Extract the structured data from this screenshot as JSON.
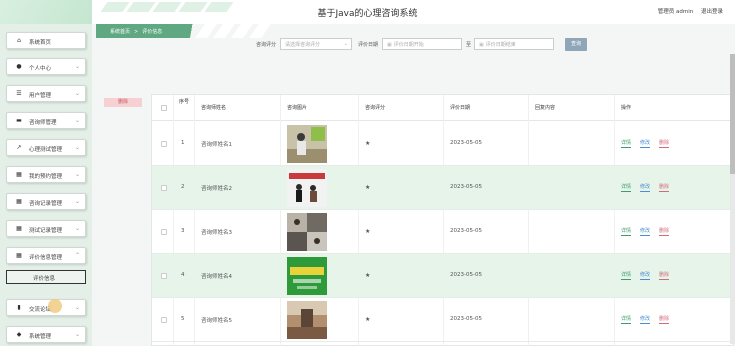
{
  "header": {
    "title": "基于Java的心理咨询系统",
    "user_label": "管理员 admin",
    "logout_label": "退出登录"
  },
  "sidebar": {
    "items": [
      {
        "label": "系统首页",
        "icon": "home-icon"
      },
      {
        "label": "个人中心",
        "icon": "user-icon"
      },
      {
        "label": "用户管理",
        "icon": "list-icon"
      },
      {
        "label": "咨询师管理",
        "icon": "briefcase-icon"
      },
      {
        "label": "心理测试管理",
        "icon": "chart-icon"
      },
      {
        "label": "我的预约管理",
        "icon": "grid-icon"
      },
      {
        "label": "咨询记录管理",
        "icon": "grid-icon"
      },
      {
        "label": "测试记录管理",
        "icon": "grid-icon"
      },
      {
        "label": "评价信息管理",
        "icon": "grid-icon"
      },
      {
        "label": "交流论坛",
        "icon": "bar-chart-icon"
      },
      {
        "label": "系统管理",
        "icon": "shield-icon"
      }
    ],
    "sub_item": {
      "label": "评价信息"
    }
  },
  "breadcrumb": {
    "home": "系统首页",
    "separator": ">",
    "current": "评价信息"
  },
  "search": {
    "rating_label": "咨询评分",
    "rating_placeholder": "请选择咨询评分",
    "date_label": "评价日期",
    "date_start_placeholder": "评价日期开始",
    "date_to": "至",
    "date_end_placeholder": "评价日期结束",
    "query_button": "查询"
  },
  "delete_button": "删除",
  "table": {
    "columns": [
      "序号",
      "咨询师姓名",
      "咨询图片",
      "咨询评分",
      "评价日期",
      "回复内容",
      "操作"
    ],
    "rows": [
      {
        "index": "1",
        "name": "咨询师姓名1",
        "rating": "★",
        "date": "2023-05-05",
        "reply": ""
      },
      {
        "index": "2",
        "name": "咨询师姓名2",
        "rating": "★",
        "date": "2023-05-05",
        "reply": ""
      },
      {
        "index": "3",
        "name": "咨询师姓名3",
        "rating": "★",
        "date": "2023-05-05",
        "reply": ""
      },
      {
        "index": "4",
        "name": "咨询师姓名4",
        "rating": "★",
        "date": "2023-05-05",
        "reply": ""
      },
      {
        "index": "5",
        "name": "咨询师姓名5",
        "rating": "★",
        "date": "2023-05-05",
        "reply": ""
      }
    ],
    "actions": {
      "detail": "详情",
      "edit": "修改",
      "delete": "删除"
    }
  },
  "colors": {
    "accent": "#5fa881",
    "row_alt": "#e6f4ea",
    "delete_bg": "#f7d0d3",
    "query_bg": "#8fa6b9"
  }
}
